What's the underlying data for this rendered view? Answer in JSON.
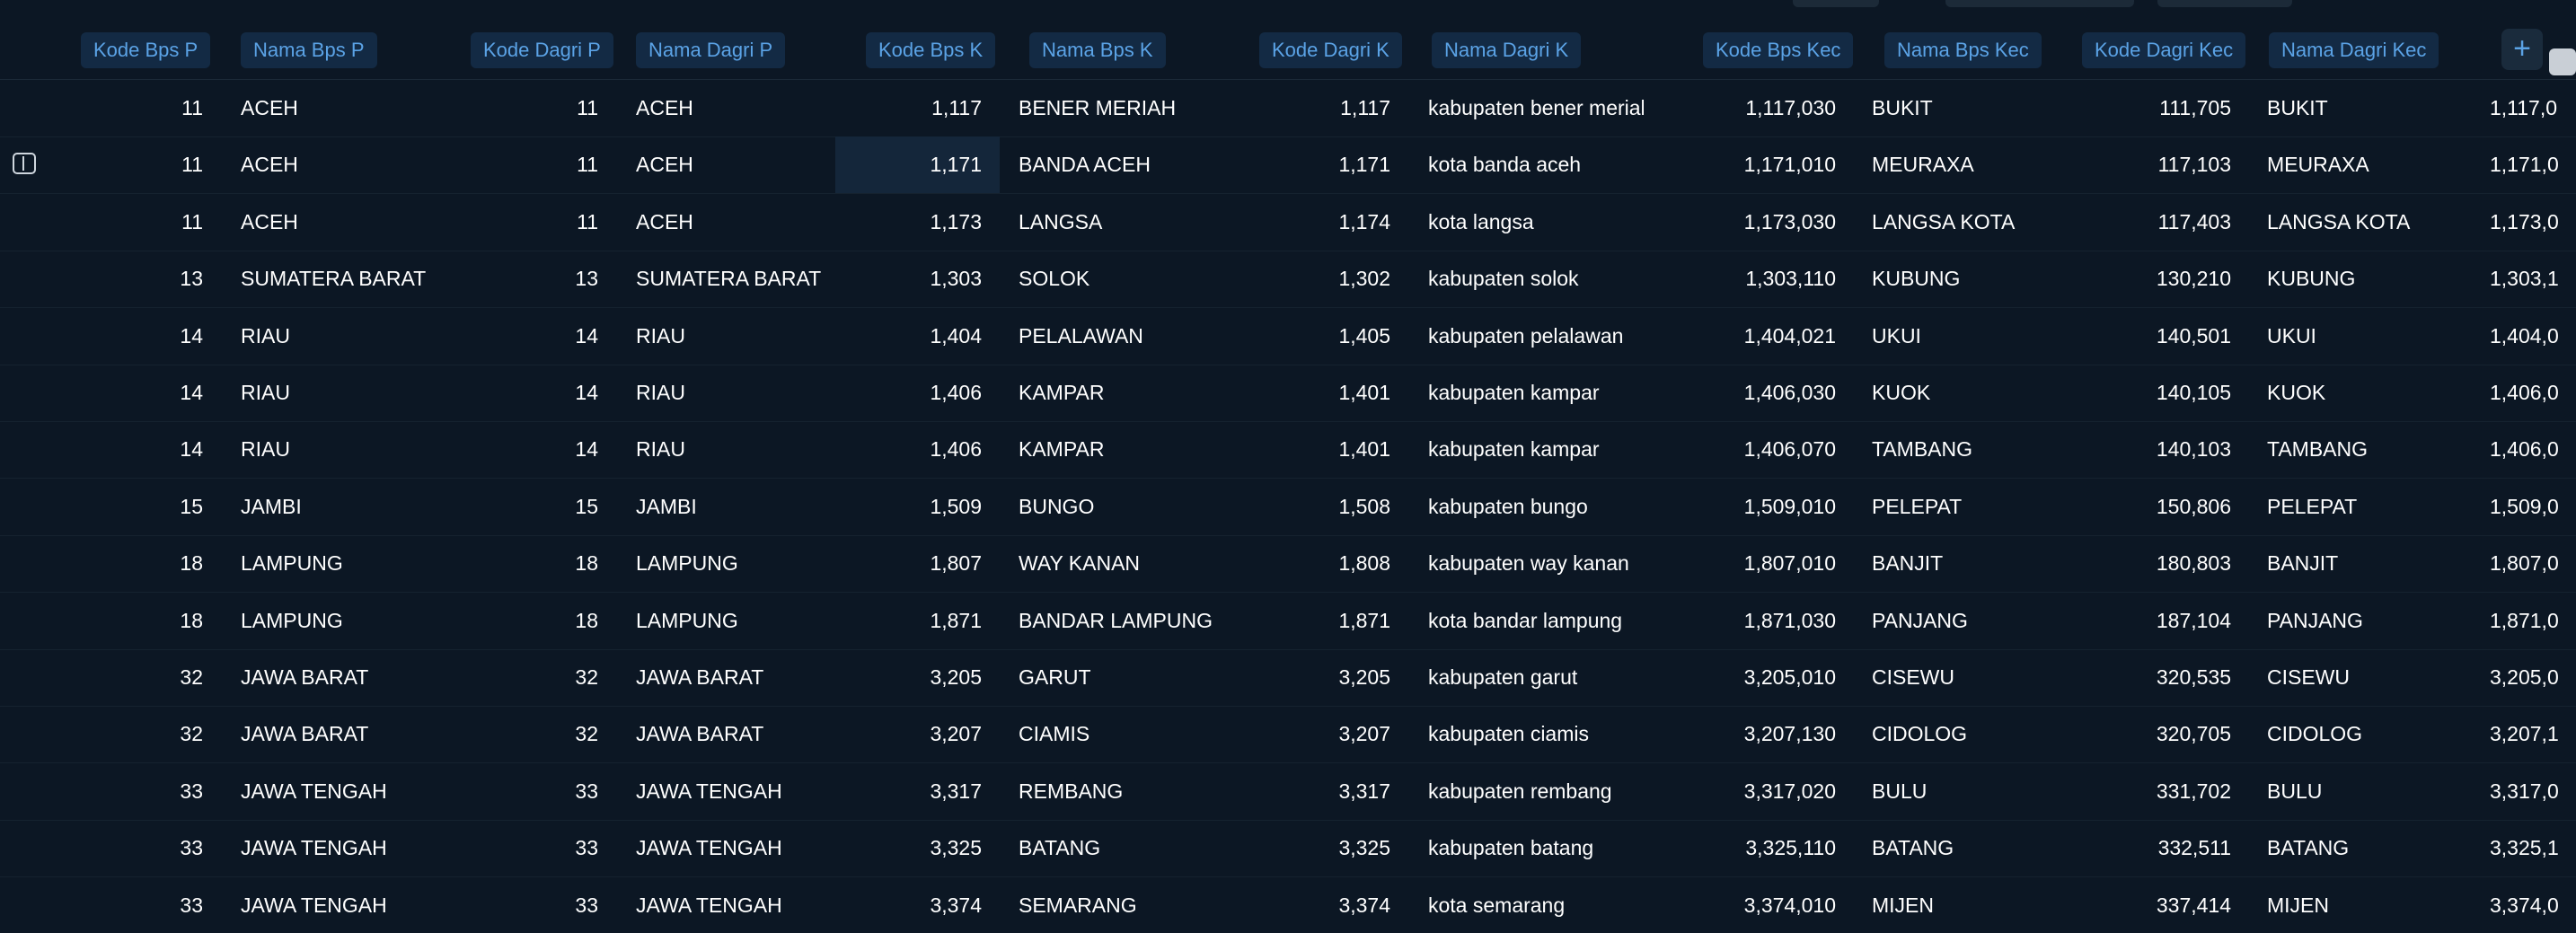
{
  "grid": {
    "columns": [
      {
        "key": "kode_bps_p",
        "label": "Kode Bps P",
        "type": "number"
      },
      {
        "key": "nama_bps_p",
        "label": "Nama Bps P",
        "type": "text"
      },
      {
        "key": "kode_dagri_p",
        "label": "Kode Dagri P",
        "type": "number"
      },
      {
        "key": "nama_dagri_p",
        "label": "Nama Dagri P",
        "type": "text"
      },
      {
        "key": "kode_bps_k",
        "label": "Kode Bps K",
        "type": "number"
      },
      {
        "key": "nama_bps_k",
        "label": "Nama Bps K",
        "type": "text"
      },
      {
        "key": "kode_dagri_k",
        "label": "Kode Dagri K",
        "type": "number"
      },
      {
        "key": "nama_dagri_k",
        "label": "Nama Dagri K",
        "type": "text"
      },
      {
        "key": "kode_bps_kec",
        "label": "Kode Bps Kec",
        "type": "number"
      },
      {
        "key": "nama_bps_kec",
        "label": "Nama Bps Kec",
        "type": "text"
      },
      {
        "key": "kode_dagri_kec",
        "label": "Kode Dagri Kec",
        "type": "number"
      },
      {
        "key": "nama_dagri_kec",
        "label": "Nama Dagri Kec",
        "type": "text"
      },
      {
        "key": "kode_bps_desa",
        "label": "",
        "type": "number"
      }
    ],
    "add_column_label": "+",
    "selected_cell": {
      "row": 1,
      "col": 4
    },
    "rows": [
      [
        "11",
        "ACEH",
        "11",
        "ACEH",
        "1,117",
        "BENER MERIAH",
        "1,117",
        "kabupaten bener meriah",
        "1,117,030",
        "BUKIT",
        "111,705",
        "BUKIT",
        "1,117,0"
      ],
      [
        "11",
        "ACEH",
        "11",
        "ACEH",
        "1,171",
        "BANDA ACEH",
        "1,171",
        "kota banda aceh",
        "1,171,010",
        "MEURAXA",
        "117,103",
        "MEURAXA",
        "1,171,0"
      ],
      [
        "11",
        "ACEH",
        "11",
        "ACEH",
        "1,173",
        "LANGSA",
        "1,174",
        "kota langsa",
        "1,173,030",
        "LANGSA KOTA",
        "117,403",
        "LANGSA KOTA",
        "1,173,0"
      ],
      [
        "13",
        "SUMATERA BARAT",
        "13",
        "SUMATERA BARAT",
        "1,303",
        "SOLOK",
        "1,302",
        "kabupaten solok",
        "1,303,110",
        "KUBUNG",
        "130,210",
        "KUBUNG",
        "1,303,1"
      ],
      [
        "14",
        "RIAU",
        "14",
        "RIAU",
        "1,404",
        "PELALAWAN",
        "1,405",
        "kabupaten pelalawan",
        "1,404,021",
        "UKUI",
        "140,501",
        "UKUI",
        "1,404,0"
      ],
      [
        "14",
        "RIAU",
        "14",
        "RIAU",
        "1,406",
        "KAMPAR",
        "1,401",
        "kabupaten kampar",
        "1,406,030",
        "KUOK",
        "140,105",
        "KUOK",
        "1,406,0"
      ],
      [
        "14",
        "RIAU",
        "14",
        "RIAU",
        "1,406",
        "KAMPAR",
        "1,401",
        "kabupaten kampar",
        "1,406,070",
        "TAMBANG",
        "140,103",
        "TAMBANG",
        "1,406,0"
      ],
      [
        "15",
        "JAMBI",
        "15",
        "JAMBI",
        "1,509",
        "BUNGO",
        "1,508",
        "kabupaten bungo",
        "1,509,010",
        "PELEPAT",
        "150,806",
        "PELEPAT",
        "1,509,0"
      ],
      [
        "18",
        "LAMPUNG",
        "18",
        "LAMPUNG",
        "1,807",
        "WAY KANAN",
        "1,808",
        "kabupaten way kanan",
        "1,807,010",
        "BANJIT",
        "180,803",
        "BANJIT",
        "1,807,0"
      ],
      [
        "18",
        "LAMPUNG",
        "18",
        "LAMPUNG",
        "1,871",
        "BANDAR LAMPUNG",
        "1,871",
        "kota bandar lampung",
        "1,871,030",
        "PANJANG",
        "187,104",
        "PANJANG",
        "1,871,0"
      ],
      [
        "32",
        "JAWA BARAT",
        "32",
        "JAWA BARAT",
        "3,205",
        "GARUT",
        "3,205",
        "kabupaten garut",
        "3,205,010",
        "CISEWU",
        "320,535",
        "CISEWU",
        "3,205,0"
      ],
      [
        "32",
        "JAWA BARAT",
        "32",
        "JAWA BARAT",
        "3,207",
        "CIAMIS",
        "3,207",
        "kabupaten ciamis",
        "3,207,130",
        "CIDOLOG",
        "320,705",
        "CIDOLOG",
        "3,207,1"
      ],
      [
        "33",
        "JAWA TENGAH",
        "33",
        "JAWA TENGAH",
        "3,317",
        "REMBANG",
        "3,317",
        "kabupaten rembang",
        "3,317,020",
        "BULU",
        "331,702",
        "BULU",
        "3,317,0"
      ],
      [
        "33",
        "JAWA TENGAH",
        "33",
        "JAWA TENGAH",
        "3,325",
        "BATANG",
        "3,325",
        "kabupaten batang",
        "3,325,110",
        "BATANG",
        "332,511",
        "BATANG",
        "3,325,1"
      ],
      [
        "33",
        "JAWA TENGAH",
        "33",
        "JAWA TENGAH",
        "3,374",
        "SEMARANG",
        "3,374",
        "kota semarang",
        "3,374,010",
        "MIJEN",
        "337,414",
        "MIJEN",
        "3,374,0"
      ]
    ]
  }
}
